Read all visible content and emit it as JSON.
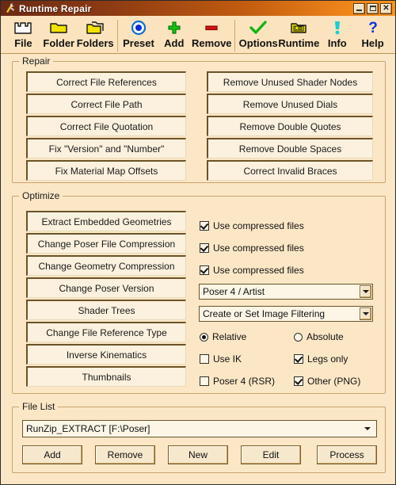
{
  "window": {
    "title": "Runtime Repair",
    "icon": "runtime-repair-app-icon",
    "controls": {
      "minimize": "Minimize",
      "maximize": "Maximize",
      "close": "Close"
    }
  },
  "toolbar": {
    "items": [
      {
        "label": "File",
        "icon": "file-open-icon"
      },
      {
        "label": "Folder",
        "icon": "folder-icon"
      },
      {
        "label": "Folders",
        "icon": "folders-icon"
      },
      {
        "label": "Preset",
        "icon": "preset-target-icon"
      },
      {
        "label": "Add",
        "icon": "plus-icon"
      },
      {
        "label": "Remove",
        "icon": "minus-icon"
      },
      {
        "label": "Options",
        "icon": "checkmark-icon"
      },
      {
        "label": "Runtime",
        "icon": "lib-folder-icon"
      },
      {
        "label": "Info",
        "icon": "info-exclamation-icon"
      },
      {
        "label": "Help",
        "icon": "question-mark-icon"
      }
    ]
  },
  "repair": {
    "legend": "Repair",
    "left_buttons": [
      "Correct File References",
      "Correct File Path",
      "Correct File Quotation",
      "Fix \"Version\" and \"Number\"",
      "Fix Material Map Offsets"
    ],
    "right_buttons": [
      "Remove Unused Shader Nodes",
      "Remove Unused Dials",
      "Remove Double Quotes",
      "Remove Double Spaces",
      "Correct Invalid Braces"
    ]
  },
  "optimize": {
    "legend": "Optimize",
    "buttons": [
      "Extract Embedded Geometries",
      "Change Poser File Compression",
      "Change Geometry Compression",
      "Change Poser Version",
      "Shader Trees",
      "Change File Reference Type",
      "Inverse Kinematics",
      "Thumbnails"
    ],
    "checkboxes": [
      {
        "label": "Use compressed files",
        "checked": true
      },
      {
        "label": "Use compressed files",
        "checked": true
      },
      {
        "label": "Use compressed files",
        "checked": true
      }
    ],
    "version_combo": {
      "value": "Poser 4 / Artist"
    },
    "shader_combo": {
      "value": "Create or Set Image Filtering"
    },
    "reference_radios": [
      {
        "label": "Relative",
        "checked": true
      },
      {
        "label": "Absolute",
        "checked": false
      }
    ],
    "ik_options": [
      {
        "label": "Use IK",
        "checked": false
      },
      {
        "label": "Legs only",
        "checked": true
      }
    ],
    "thumb_options": [
      {
        "label": "Poser 4 (RSR)",
        "checked": false
      },
      {
        "label": "Other (PNG)",
        "checked": true
      }
    ]
  },
  "file_list": {
    "legend": "File List",
    "selected": "RunZip_EXTRACT [F:\\Poser]",
    "buttons": [
      "Add",
      "Remove",
      "New",
      "Edit",
      "Process"
    ]
  },
  "colors": {
    "window_bg": "#fbe7c6",
    "toolbar_bg": "#fbe3bd",
    "button_face": "#fbf1de",
    "button_border": "#6b5327",
    "group_border": "#c9a36a",
    "title_start": "#6b2a14",
    "title_end": "#f79420",
    "folder_yellow": "#f2e300",
    "preset_blue": "#0a6ed8",
    "add_green": "#12c412",
    "remove_red": "#d01414",
    "options_green": "#12b512",
    "info_cyan": "#12d0d8",
    "help_blue": "#0b2fe0"
  }
}
